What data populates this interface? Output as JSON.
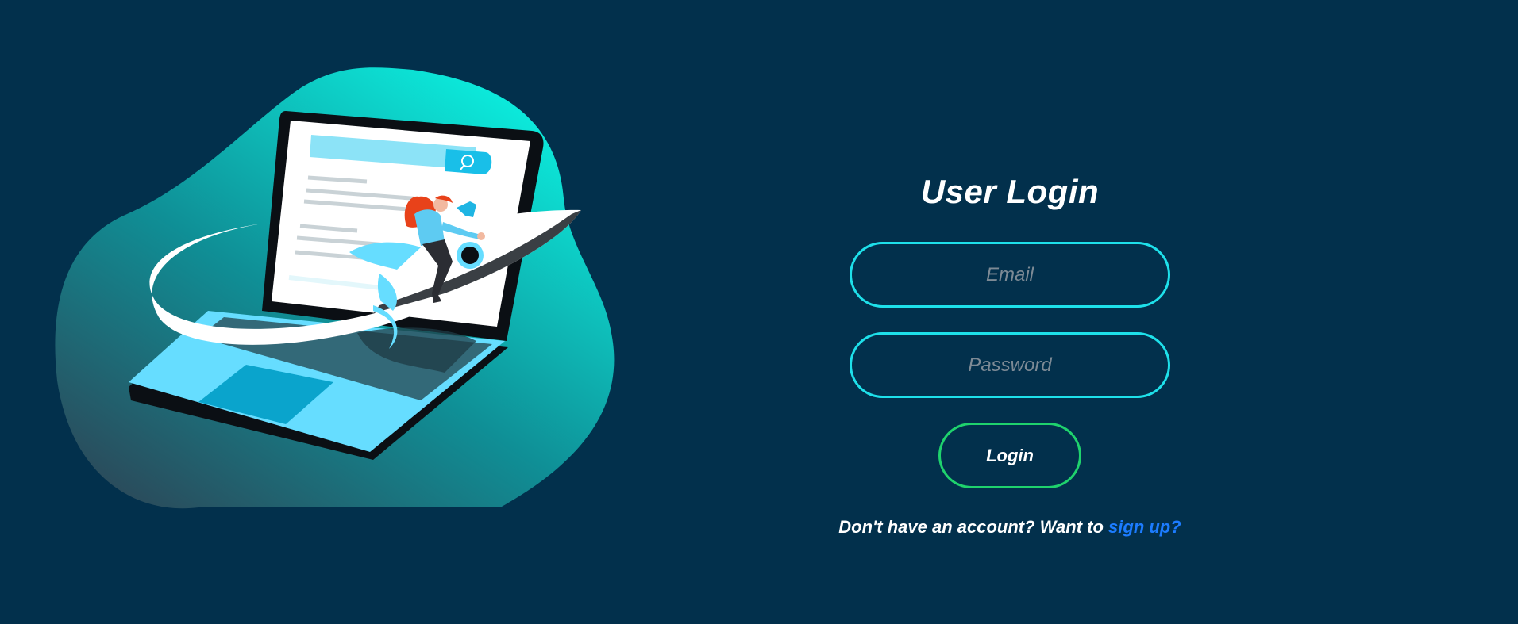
{
  "login": {
    "title": "User Login",
    "email_placeholder": "Email",
    "password_placeholder": "Password",
    "login_label": "Login",
    "signup_prompt": "Don't have an account? Want to ",
    "signup_link": "sign up?"
  },
  "colors": {
    "background": "#02304c",
    "field_border": "#1ee0ea",
    "button_border": "#1fd26d",
    "link": "#1c7cff",
    "blob_start": "#0ff0e0",
    "blob_end": "#235a68"
  },
  "illustration": {
    "icons": [
      "laptop",
      "search-icon",
      "rocket",
      "person-with-megaphone"
    ]
  }
}
